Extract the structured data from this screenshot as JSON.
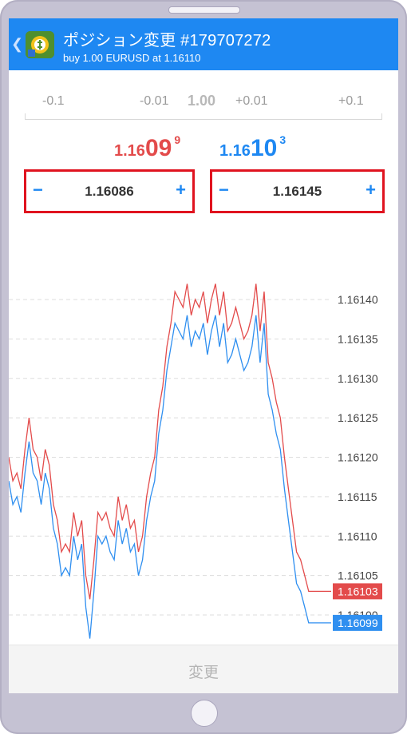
{
  "header": {
    "title": "ポジション変更 #179707272",
    "subtitle": "buy 1.00 EURUSD at 1.16110"
  },
  "volume": {
    "minus_large": "-0.1",
    "minus_small": "-0.01",
    "current": "1.00",
    "plus_small": "+0.01",
    "plus_large": "+0.1"
  },
  "quotes": {
    "bid": {
      "prefix": "1.16",
      "big": "09",
      "sup": "9"
    },
    "ask": {
      "prefix": "1.16",
      "big": "10",
      "sup": "3"
    }
  },
  "stop_loss": {
    "minus": "−",
    "value": "1.16086",
    "plus": "+"
  },
  "take_profit": {
    "minus": "−",
    "value": "1.16145",
    "plus": "+"
  },
  "chart_data": {
    "type": "line",
    "y_ticks": [
      "1.16140",
      "1.16135",
      "1.16130",
      "1.16125",
      "1.16120",
      "1.16115",
      "1.16110",
      "1.16105",
      "1.16100"
    ],
    "ylim": [
      1.16095,
      1.16145
    ],
    "grid": true,
    "series": [
      {
        "color": "#e34b4b",
        "last_label": "1.16103",
        "values": [
          1.1612,
          1.16117,
          1.16118,
          1.16116,
          1.16121,
          1.16125,
          1.16121,
          1.1612,
          1.16117,
          1.16121,
          1.16119,
          1.16114,
          1.16112,
          1.16108,
          1.16109,
          1.16108,
          1.16113,
          1.1611,
          1.16112,
          1.16105,
          1.16102,
          1.16107,
          1.16113,
          1.16112,
          1.16113,
          1.16111,
          1.1611,
          1.16115,
          1.16112,
          1.16114,
          1.16111,
          1.16112,
          1.16108,
          1.1611,
          1.16115,
          1.16118,
          1.1612,
          1.16126,
          1.16129,
          1.16134,
          1.16137,
          1.16141,
          1.1614,
          1.16139,
          1.16142,
          1.16138,
          1.1614,
          1.16139,
          1.16141,
          1.16137,
          1.1614,
          1.16142,
          1.16138,
          1.16141,
          1.16136,
          1.16137,
          1.16139,
          1.16137,
          1.16135,
          1.16136,
          1.16138,
          1.16142,
          1.16136,
          1.16141,
          1.16132,
          1.1613,
          1.16127,
          1.16125,
          1.1612,
          1.16116,
          1.16112,
          1.16108,
          1.16107,
          1.16105,
          1.16103,
          1.16103,
          1.16103
        ]
      },
      {
        "color": "#2f8ff0",
        "last_label": "1.16099",
        "values": [
          1.16117,
          1.16114,
          1.16115,
          1.16113,
          1.16118,
          1.16122,
          1.16118,
          1.16117,
          1.16114,
          1.16118,
          1.16116,
          1.16111,
          1.16109,
          1.16105,
          1.16106,
          1.16105,
          1.1611,
          1.16107,
          1.16109,
          1.16101,
          1.16097,
          1.16103,
          1.1611,
          1.16109,
          1.1611,
          1.16108,
          1.16107,
          1.16112,
          1.16109,
          1.16111,
          1.16108,
          1.16109,
          1.16105,
          1.16107,
          1.16112,
          1.16115,
          1.16117,
          1.16123,
          1.16126,
          1.16131,
          1.16134,
          1.16137,
          1.16136,
          1.16135,
          1.16138,
          1.16134,
          1.16136,
          1.16135,
          1.16137,
          1.16133,
          1.16136,
          1.16138,
          1.16134,
          1.16137,
          1.16132,
          1.16133,
          1.16135,
          1.16133,
          1.16131,
          1.16132,
          1.16134,
          1.16138,
          1.16132,
          1.16137,
          1.16128,
          1.16126,
          1.16123,
          1.16121,
          1.16116,
          1.16112,
          1.16108,
          1.16104,
          1.16103,
          1.16101,
          1.16099,
          1.16099,
          1.16099
        ]
      }
    ]
  },
  "footer": {
    "button_label": "変更"
  },
  "colors": {
    "header_bg": "#1e88f2",
    "bid": "#e34b4b",
    "ask": "#1e88f2",
    "highlight_border": "#e0131f"
  }
}
